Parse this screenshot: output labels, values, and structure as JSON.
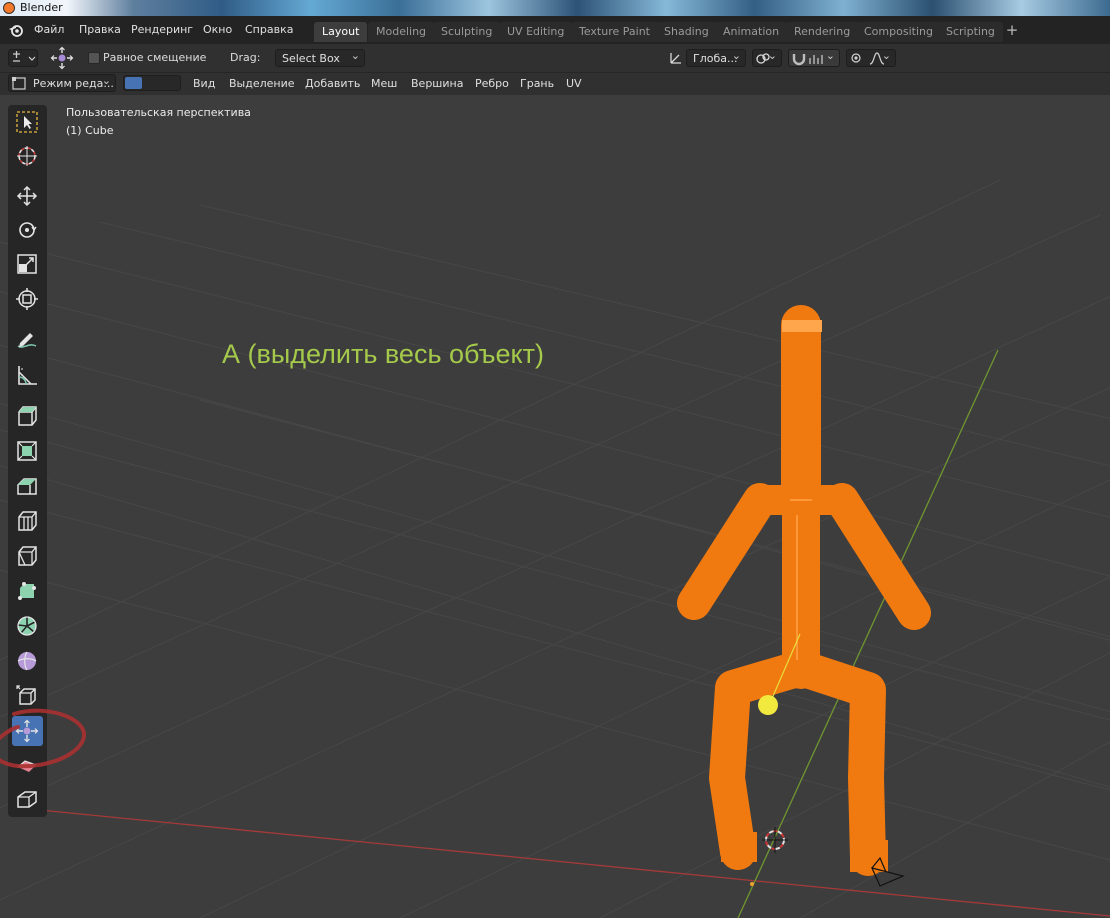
{
  "window": {
    "title": "Blender"
  },
  "menu": [
    "Файл",
    "Правка",
    "Рендеринг",
    "Окно",
    "Справка"
  ],
  "workspaces": [
    {
      "label": "Layout",
      "active": true
    },
    {
      "label": "Modeling"
    },
    {
      "label": "Sculpting"
    },
    {
      "label": "UV Editing"
    },
    {
      "label": "Texture Paint"
    },
    {
      "label": "Shading"
    },
    {
      "label": "Animation"
    },
    {
      "label": "Rendering"
    },
    {
      "label": "Compositing"
    },
    {
      "label": "Scripting"
    }
  ],
  "tool_header": {
    "checkbox_label": "Равное смещение",
    "drag_label": "Drag:",
    "drag_value": "Select Box",
    "orientation": "Глоба..."
  },
  "header_3d": {
    "mode": "Режим реда...",
    "menus": [
      "Вид",
      "Выделение",
      "Добавить",
      "Меш",
      "Вершина",
      "Ребро",
      "Грань",
      "UV"
    ]
  },
  "viewport": {
    "perspective": "Пользовательская перспектива",
    "object": "(1) Cube",
    "annotation": "А (выделить весь объект)"
  },
  "tools": [
    {
      "name": "select-box-icon"
    },
    {
      "name": "cursor-icon"
    },
    {
      "name": "move-icon"
    },
    {
      "name": "rotate-icon"
    },
    {
      "name": "scale-icon"
    },
    {
      "name": "transform-icon"
    },
    {
      "name": "annotate-icon"
    },
    {
      "name": "measure-icon"
    },
    {
      "name": "add-cube-icon"
    },
    {
      "name": "extrude-region-icon"
    },
    {
      "name": "inset-faces-icon"
    },
    {
      "name": "bevel-icon"
    },
    {
      "name": "loop-cut-icon"
    },
    {
      "name": "knife-icon"
    },
    {
      "name": "poly-build-icon"
    },
    {
      "name": "spin-icon"
    },
    {
      "name": "smooth-icon"
    },
    {
      "name": "edge-slide-icon"
    },
    {
      "name": "shrink-fatten-icon",
      "active": true
    },
    {
      "name": "shear-icon"
    },
    {
      "name": "rip-region-icon"
    }
  ],
  "colors": {
    "accent": "#4772b3",
    "selection": "#f5780f",
    "annotation": "#a4c94b",
    "x_axis": "#b13c3c",
    "y_axis": "#7ea632"
  }
}
